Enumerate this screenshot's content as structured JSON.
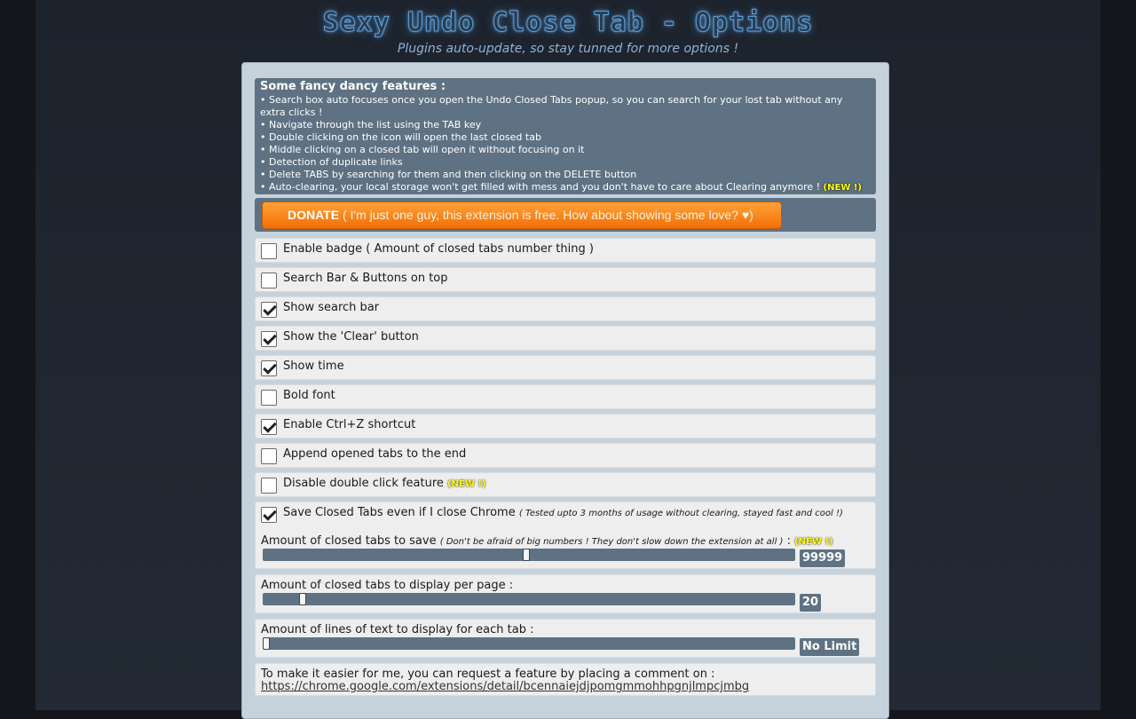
{
  "header": {
    "title": "Sexy Undo Close Tab - Options",
    "subtitle": "Plugins auto-update, so stay tunned for more options !"
  },
  "features": {
    "heading": "Some fancy dancy features :",
    "items": [
      "• Search box auto focuses once you open the Undo Closed Tabs popup, so you can search for your lost tab without any extra clicks !",
      "• Navigate through the list using the TAB key",
      "• Double clicking on the icon will open the last closed tab",
      "• Middle clicking on a closed tab will open it without focusing on it",
      "• Detection of duplicate links",
      "• Delete TABS by searching for them and then clicking on the DELETE button",
      "• Auto-clearing, your local storage won't get filled with mess and you don't have to care about Clearing anymore !"
    ],
    "new_tag": "(NEW !)"
  },
  "donate": {
    "label": "DONATE",
    "message": " ( I'm just one guy, this extension is free. How about showing some love? ♥)"
  },
  "options": [
    {
      "label": "Enable badge ( Amount of closed tabs number thing )",
      "checked": false
    },
    {
      "label": "Search Bar & Buttons on top",
      "checked": false
    },
    {
      "label": "Show search bar",
      "checked": true
    },
    {
      "label": "Show the 'Clear' button",
      "checked": true
    },
    {
      "label": "Show time",
      "checked": true
    },
    {
      "label": "Bold font",
      "checked": false
    },
    {
      "label": "Enable Ctrl+Z shortcut",
      "checked": true
    },
    {
      "label": "Append opened tabs to the end",
      "checked": false
    },
    {
      "label": "Disable double click feature",
      "checked": false,
      "new_tag": "(NEW !)"
    }
  ],
  "save_closed": {
    "label": "Save Closed Tabs even if I close Chrome",
    "note": "( Tested upto 3 months of usage without clearing, stayed fast and cool !)",
    "checked": true,
    "amount_label": "Amount of closed tabs to save",
    "amount_note": "( Don't be afraid of big numbers ! They don't slow down the extension at all )",
    "amount_suffix": " :",
    "new_tag": "(NEW !)",
    "slider_fraction": 0.495,
    "value": "99999"
  },
  "per_page": {
    "label": "Amount of closed tabs to display per page :",
    "slider_fraction": 0.07,
    "value": "20"
  },
  "lines": {
    "label": "Amount of lines of text to display for each tab :",
    "slider_fraction": 0.0,
    "value": "No Limit"
  },
  "feature_request": {
    "text": "To make it easier for me, you can request a feature by placing a comment on :",
    "link": "https://chrome.google.com/extensions/detail/bcennaiejdjpomgmmohhpgnjlmpcjmbg"
  }
}
